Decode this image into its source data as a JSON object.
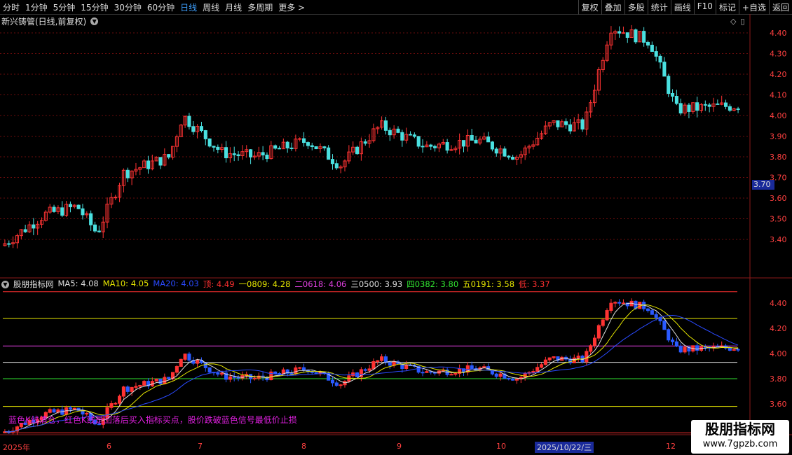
{
  "toolbar": {
    "periods": [
      "分时",
      "1分钟",
      "5分钟",
      "15分钟",
      "30分钟",
      "60分钟",
      "日线",
      "周线",
      "月线",
      "多周期",
      "更多 >"
    ],
    "active_period": "日线",
    "right_buttons": [
      "复权",
      "叠加",
      "多股",
      "统计",
      "画线",
      "F10",
      "标记",
      "+自选",
      "返回"
    ]
  },
  "title": {
    "text": "新兴铸管(日线,前复权)"
  },
  "price_axis": {
    "labels": [
      "4.40",
      "4.30",
      "4.20",
      "4.10",
      "4.00",
      "3.90",
      "3.80",
      "3.70",
      "3.60",
      "3.50",
      "3.40"
    ]
  },
  "current_price": "3.70",
  "indicator": {
    "name": "股朋指标网",
    "fields": [
      {
        "label": "MA5: 4.08",
        "color": "#dddddd"
      },
      {
        "label": "MA10: 4.05",
        "color": "#e6e600"
      },
      {
        "label": "MA20: 4.03",
        "color": "#2a4aff"
      },
      {
        "label": "顶: 4.49",
        "color": "#ff3030"
      },
      {
        "label": "一0809: 4.28",
        "color": "#e6e600"
      },
      {
        "label": "二0618: 4.06",
        "color": "#e040e0"
      },
      {
        "label": "三0500: 3.93",
        "color": "#dddddd"
      },
      {
        "label": "四0382: 3.80",
        "color": "#30e030"
      },
      {
        "label": "五0191: 3.58",
        "color": "#e6e600"
      },
      {
        "label": "低: 3.37",
        "color": "#ff3030"
      }
    ],
    "axis_labels": [
      "4.40",
      "4.20",
      "4.00",
      "3.80",
      "3.60"
    ],
    "note": "蓝色K线清仓，红色K线是回落后买入指标买点，股价跌破蓝色信号最低价止损"
  },
  "date_axis": [
    "2025年",
    "6",
    "7",
    "8",
    "9",
    "10",
    "12"
  ],
  "date_highlight": "2025/10/22/三",
  "watermark": {
    "title": "股朋指标网",
    "url": "www.7gpzb.com"
  },
  "colors": {
    "up": "#ff3333",
    "down": "#4ae0e0",
    "down_ind": "#2a5aff"
  }
}
